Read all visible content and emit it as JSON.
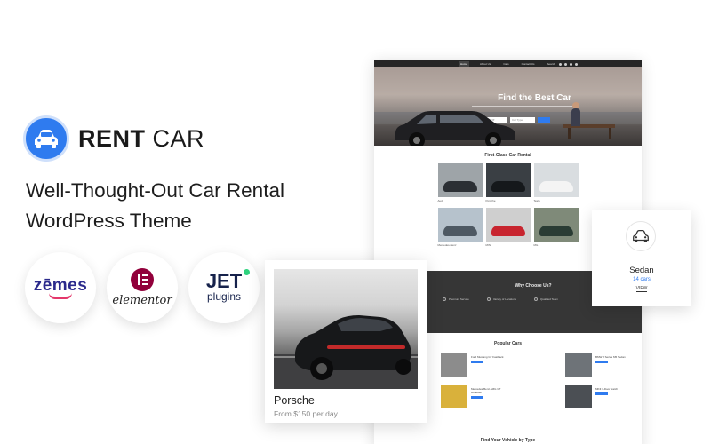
{
  "brand": {
    "name_bold": "RENT",
    "name_light": "CAR",
    "logo_icon": "car-icon",
    "accent_color": "#2f7bef"
  },
  "tagline": {
    "line1": "Well-Thought-Out Car Rental",
    "line2": "WordPress Theme"
  },
  "badges": {
    "zemes": "zēmes",
    "elementor": "elementor",
    "jet_top": "JET",
    "jet_bottom": "plugins"
  },
  "site": {
    "nav": [
      "Home",
      "About Us",
      "Cars",
      "Contact Us",
      "Search"
    ],
    "hero_title": "Find the Best Car",
    "search_fields": [
      "Pick Up",
      "Drop Off",
      "Car Type"
    ],
    "rental_title": "First-Class Car Rental",
    "cars": [
      {
        "label": "Audi",
        "bg": "#9ea4a8",
        "car": "#2b2f34"
      },
      {
        "label": "Porsche",
        "bg": "#3a3f44",
        "car": "#15181b"
      },
      {
        "label": "Tesla",
        "bg": "#d9dde0",
        "car": "#f4f4f4"
      },
      {
        "label": "Mercedes-Benz",
        "bg": "#b6c2cc",
        "car": "#4e5963"
      },
      {
        "label": "MINI",
        "bg": "#cfcfcf",
        "car": "#c8252f"
      },
      {
        "label": "MG",
        "bg": "#7f8a79",
        "car": "#2a3c34"
      }
    ],
    "why_title": "Why Choose Us?",
    "why_items": [
      "Premium Service",
      "Variety of Locations",
      "Qualified Team"
    ],
    "popular_title": "Popular Cars",
    "popular": [
      {
        "name": "Ford Mustang GT Fastback",
        "bg": "#8c8c8c"
      },
      {
        "name": "BMW 8 Series M5 Sedan",
        "bg": "#6e7378"
      },
      {
        "name": "Mercedes-Benz AMG GT Roadster",
        "bg": "#d9b13b"
      },
      {
        "name": "MINI 3-Door Hatch",
        "bg": "#4b4f54"
      }
    ],
    "find_title": "Find Your Vehicle by Type"
  },
  "card": {
    "title": "Porsche",
    "price": "From $150 per day"
  },
  "sedan": {
    "title": "Sedan",
    "count": "14 cars",
    "view": "VIEW",
    "icon": "car-icon"
  }
}
